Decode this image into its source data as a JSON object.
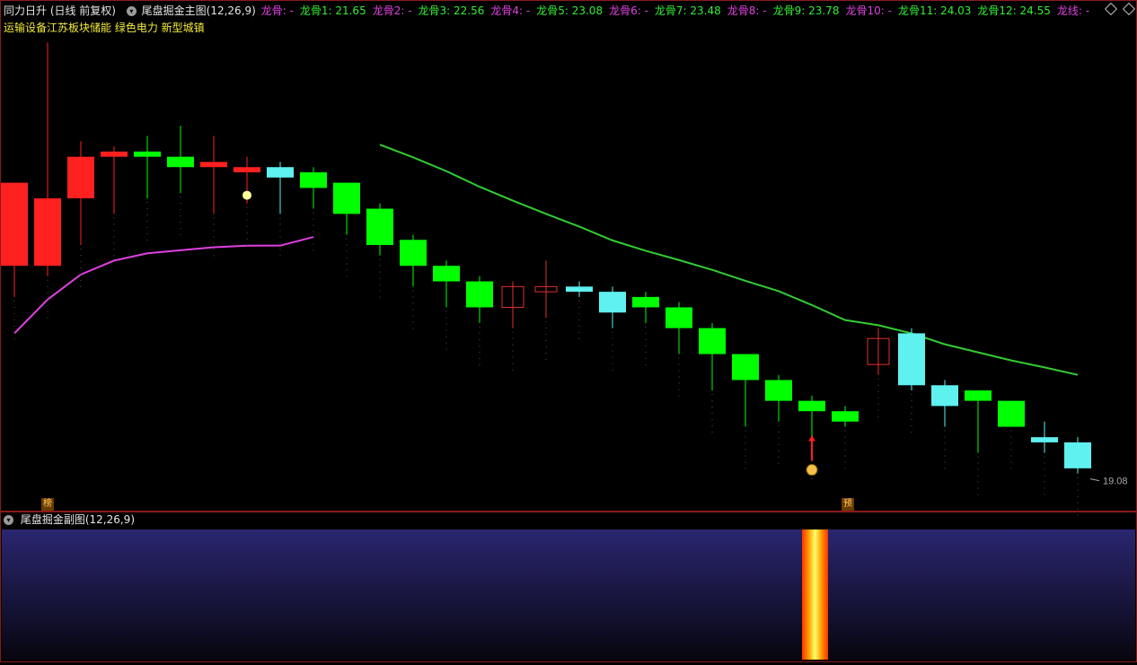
{
  "header": {
    "stock_title": "同力日升 (日线 前复权)",
    "indicator_title": "尾盘掘金主图(12,26,9)",
    "params": [
      {
        "label": "龙骨: -",
        "color": "#e040e0"
      },
      {
        "label": "龙骨1: 21.65",
        "color": "#33ee33"
      },
      {
        "label": "龙骨2: -",
        "color": "#e040e0"
      },
      {
        "label": "龙骨3: 22.56",
        "color": "#33ee33"
      },
      {
        "label": "龙骨4: -",
        "color": "#e040e0"
      },
      {
        "label": "龙骨5: 23.08",
        "color": "#33ee33"
      },
      {
        "label": "龙骨6: -",
        "color": "#e040e0"
      },
      {
        "label": "龙骨7: 23.48",
        "color": "#33ee33"
      },
      {
        "label": "龙骨8: -",
        "color": "#e040e0"
      },
      {
        "label": "龙骨9: 23.78",
        "color": "#33ee33"
      },
      {
        "label": "龙骨10: -",
        "color": "#e040e0"
      },
      {
        "label": "龙骨11: 24.03",
        "color": "#33ee33"
      },
      {
        "label": "龙骨12: 24.55",
        "color": "#33ee33"
      },
      {
        "label": "龙线: -",
        "color": "#e040e0"
      }
    ],
    "sectors": "运输设备江苏板块储能 绿色电力 新型城镇"
  },
  "sub_panel": {
    "title": "尾盘掘金副图(12,26,9)"
  },
  "markers": {
    "bang": "榜",
    "yu": "预",
    "low_label": "19.08"
  },
  "colors": {
    "up": "#ff2020",
    "down_big": "#00ff00",
    "down": "#5ff0f0",
    "hollow": "#e03030",
    "ma_pink": "#e040e0",
    "ma_green": "#33cc33"
  },
  "chart_data": {
    "type": "candlestick",
    "candles": [
      {
        "o": 24.6,
        "h": 24.6,
        "l": 22.4,
        "c": 23.0,
        "style": "red"
      },
      {
        "o": 23.0,
        "h": 27.3,
        "l": 22.8,
        "c": 24.3,
        "style": "red"
      },
      {
        "o": 24.3,
        "h": 25.4,
        "l": 23.4,
        "c": 25.1,
        "style": "red"
      },
      {
        "o": 25.1,
        "h": 25.3,
        "l": 24.0,
        "c": 25.2,
        "style": "red"
      },
      {
        "o": 25.2,
        "h": 25.5,
        "l": 24.3,
        "c": 25.1,
        "style": "green"
      },
      {
        "o": 25.1,
        "h": 25.7,
        "l": 24.4,
        "c": 24.9,
        "style": "green"
      },
      {
        "o": 24.9,
        "h": 25.5,
        "l": 24.0,
        "c": 25.0,
        "style": "red"
      },
      {
        "o": 24.8,
        "h": 25.1,
        "l": 24.2,
        "c": 24.9,
        "style": "red"
      },
      {
        "o": 24.9,
        "h": 25.0,
        "l": 24.0,
        "c": 24.7,
        "style": "cyan"
      },
      {
        "o": 24.8,
        "h": 24.9,
        "l": 24.1,
        "c": 24.5,
        "style": "green"
      },
      {
        "o": 24.6,
        "h": 24.6,
        "l": 23.6,
        "c": 24.0,
        "style": "green"
      },
      {
        "o": 24.1,
        "h": 24.2,
        "l": 23.2,
        "c": 23.4,
        "style": "green"
      },
      {
        "o": 23.5,
        "h": 23.6,
        "l": 22.6,
        "c": 23.0,
        "style": "green"
      },
      {
        "o": 23.0,
        "h": 23.1,
        "l": 22.2,
        "c": 22.7,
        "style": "green"
      },
      {
        "o": 22.7,
        "h": 22.8,
        "l": 21.9,
        "c": 22.2,
        "style": "green"
      },
      {
        "o": 22.2,
        "h": 22.7,
        "l": 21.8,
        "c": 22.6,
        "style": "hollow"
      },
      {
        "o": 22.5,
        "h": 23.1,
        "l": 22.0,
        "c": 22.6,
        "style": "hollow"
      },
      {
        "o": 22.6,
        "h": 22.7,
        "l": 22.4,
        "c": 22.5,
        "style": "cyan"
      },
      {
        "o": 22.5,
        "h": 22.6,
        "l": 21.8,
        "c": 22.1,
        "style": "cyan"
      },
      {
        "o": 22.4,
        "h": 22.5,
        "l": 21.9,
        "c": 22.2,
        "style": "green"
      },
      {
        "o": 22.2,
        "h": 22.3,
        "l": 21.3,
        "c": 21.8,
        "style": "green"
      },
      {
        "o": 21.8,
        "h": 21.9,
        "l": 20.6,
        "c": 21.3,
        "style": "green"
      },
      {
        "o": 21.3,
        "h": 21.3,
        "l": 19.9,
        "c": 20.8,
        "style": "green"
      },
      {
        "o": 20.8,
        "h": 20.9,
        "l": 20.0,
        "c": 20.4,
        "style": "green"
      },
      {
        "o": 20.4,
        "h": 20.5,
        "l": 19.7,
        "c": 20.2,
        "style": "green"
      },
      {
        "o": 20.2,
        "h": 20.3,
        "l": 19.9,
        "c": 20.0,
        "style": "green"
      },
      {
        "o": 21.1,
        "h": 21.8,
        "l": 20.9,
        "c": 21.6,
        "style": "hollow"
      },
      {
        "o": 21.7,
        "h": 21.8,
        "l": 20.6,
        "c": 20.7,
        "style": "cyan"
      },
      {
        "o": 20.7,
        "h": 20.8,
        "l": 19.9,
        "c": 20.3,
        "style": "cyan"
      },
      {
        "o": 20.6,
        "h": 20.6,
        "l": 19.4,
        "c": 20.4,
        "style": "green"
      },
      {
        "o": 20.4,
        "h": 20.4,
        "l": 19.9,
        "c": 19.9,
        "style": "green"
      },
      {
        "o": 19.7,
        "h": 20.0,
        "l": 19.4,
        "c": 19.6,
        "style": "cyan"
      },
      {
        "o": 19.6,
        "h": 19.7,
        "l": 19.0,
        "c": 19.1,
        "style": "cyan"
      }
    ]
  }
}
